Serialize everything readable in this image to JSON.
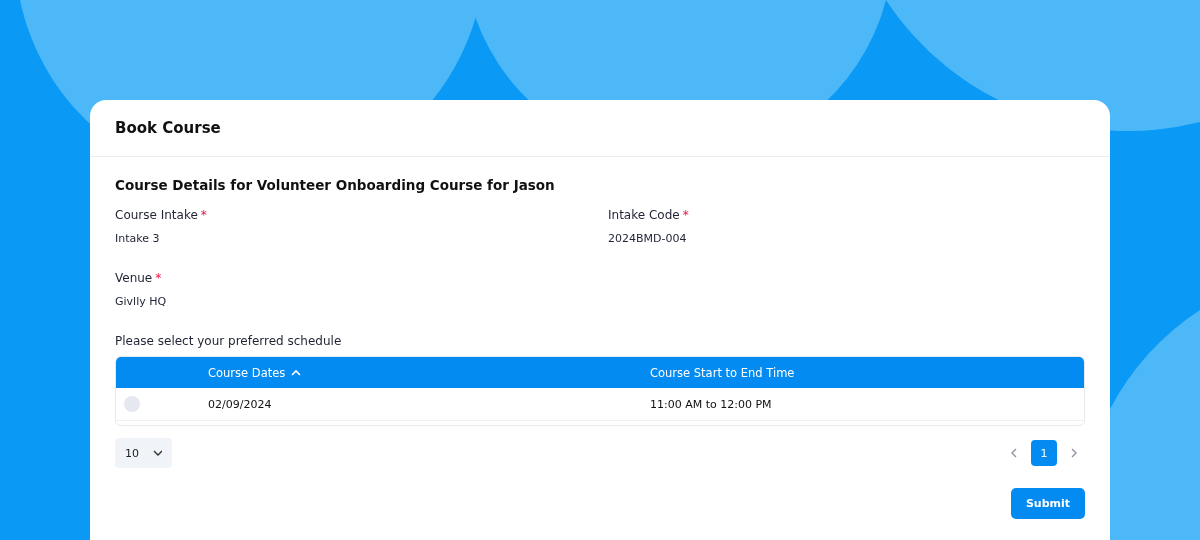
{
  "dialog": {
    "title": "Book Course"
  },
  "section_title": "Course Details for Volunteer Onboarding Course for Jason",
  "fields": [
    {
      "label": "Course Intake",
      "required": true,
      "required_mark": "*",
      "value": "Intake 3"
    },
    {
      "label": "Intake Code",
      "required": true,
      "required_mark": "*",
      "value": "2024BMD-004"
    },
    {
      "label": "Venue",
      "required": true,
      "required_mark": "*",
      "value": "Givlly HQ"
    }
  ],
  "table": {
    "caption": "Please select your preferred schedule",
    "columns": [
      {
        "label": "Course Dates",
        "sorted_ascending": true
      },
      {
        "label": "Course Start to End Time",
        "sorted_ascending": false
      }
    ],
    "rows": [
      {
        "selected": false,
        "cells": [
          "02/09/2024",
          "11:00 AM to 12:00 PM"
        ]
      }
    ]
  },
  "page_size": {
    "value": "10"
  },
  "pagination": {
    "pages": [
      {
        "label": "1",
        "selected": true
      }
    ]
  },
  "buttons": [
    {
      "label": "Submit"
    }
  ]
}
